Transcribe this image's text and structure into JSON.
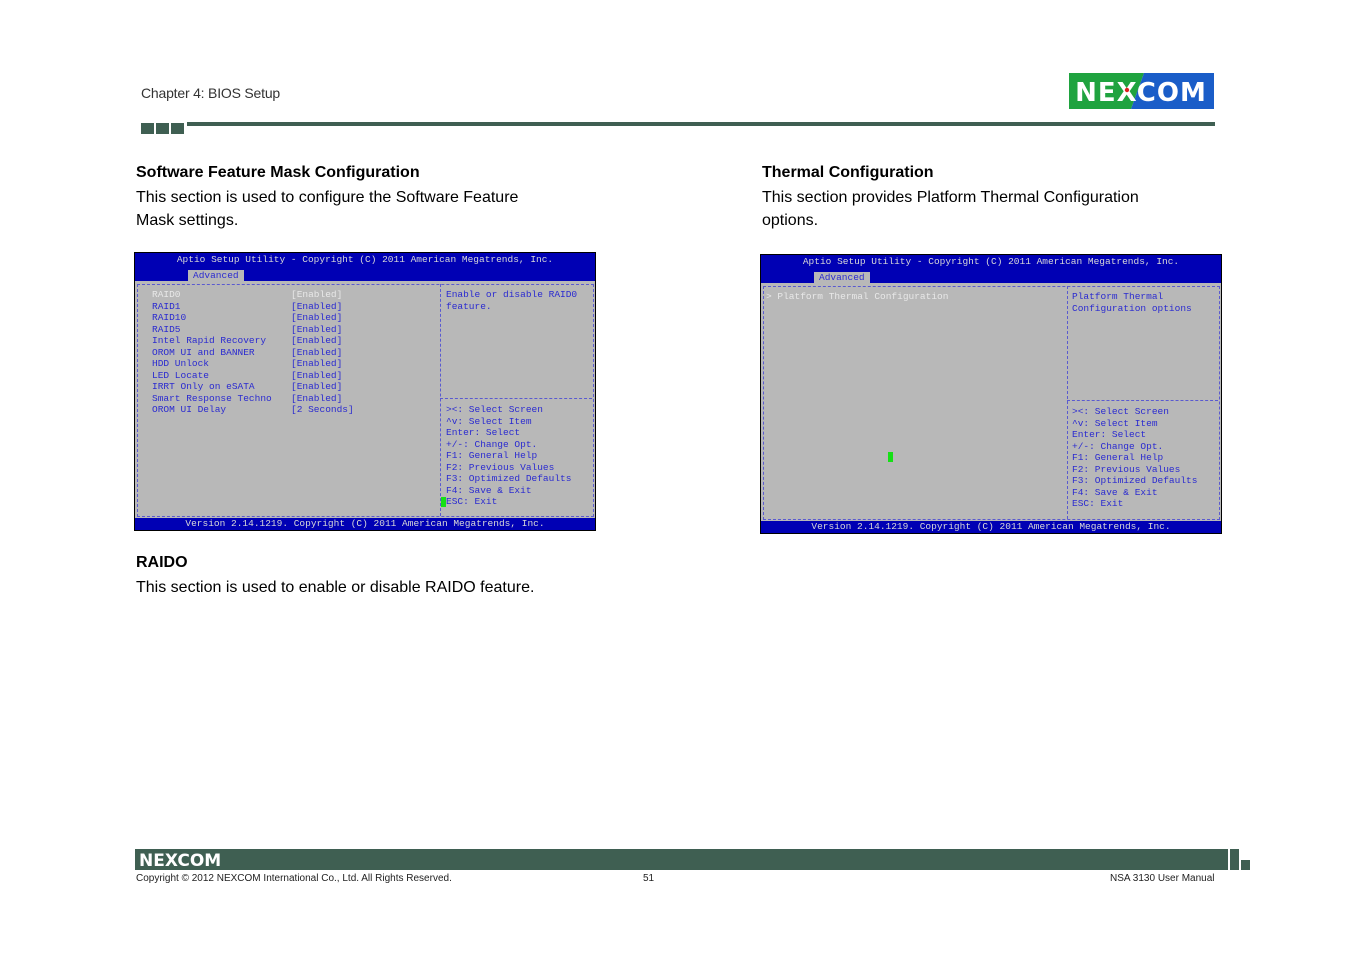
{
  "header": {
    "chapter": "Chapter 4: BIOS Setup",
    "logo_text": "NEXCOM",
    "brand_colors": {
      "green": "#1fa33f",
      "blue": "#1a5dc8",
      "rule": "#3f5f52"
    }
  },
  "left": {
    "section1": {
      "title": "Software Feature Mask Configuration",
      "body_line1": "This section is used to configure the Software Feature",
      "body_line2": "Mask settings."
    },
    "bios": {
      "title": "Aptio Setup Utility - Copyright (C) 2011 American Megatrends, Inc.",
      "tab": "Advanced",
      "items": [
        {
          "label": "RAID0",
          "value": "[Enabled]"
        },
        {
          "label": "RAID1",
          "value": "[Enabled]"
        },
        {
          "label": "RAID10",
          "value": "[Enabled]"
        },
        {
          "label": "RAID5",
          "value": "[Enabled]"
        },
        {
          "label": "Intel Rapid Recovery",
          "value": "[Enabled]"
        },
        {
          "label": "OROM UI and BANNER",
          "value": "[Enabled]"
        },
        {
          "label": "HDD Unlock",
          "value": "[Enabled]"
        },
        {
          "label": "LED Locate",
          "value": "[Enabled]"
        },
        {
          "label": "IRRT Only on eSATA",
          "value": "[Enabled]"
        },
        {
          "label": "Smart Response Techno",
          "value": "[Enabled]"
        },
        {
          "label": "OROM UI Delay",
          "value": "[2 Seconds]"
        }
      ],
      "help": [
        "Enable or disable RAID0",
        "feature."
      ],
      "keys": [
        "><: Select Screen",
        "^v: Select Item",
        "Enter: Select",
        "+/-: Change Opt.",
        "F1: General Help",
        "F2: Previous Values",
        "F3: Optimized Defaults",
        "F4: Save & Exit",
        "ESC: Exit"
      ],
      "footer": "Version 2.14.1219. Copyright (C) 2011 American Megatrends, Inc."
    },
    "section2": {
      "title": "RAIDO",
      "body": "This section is used to enable or disable RAIDO feature."
    }
  },
  "right": {
    "section": {
      "title": "Thermal Configuration",
      "body_line1": "This section provides Platform Thermal Configuration",
      "body_line2": "options."
    },
    "bios": {
      "title": "Aptio Setup Utility - Copyright (C) 2011 American Megatrends, Inc.",
      "tab": "Advanced",
      "items": [
        {
          "label": "> Platform Thermal Configuration"
        }
      ],
      "help": [
        "Platform Thermal",
        "Configuration options"
      ],
      "keys": [
        "><: Select Screen",
        "^v: Select Item",
        "Enter: Select",
        "+/-: Change Opt.",
        "F1: General Help",
        "F2: Previous Values",
        "F3: Optimized Defaults",
        "F4: Save & Exit",
        "ESC: Exit"
      ],
      "footer": "Version 2.14.1219. Copyright (C) 2011 American Megatrends, Inc."
    }
  },
  "footer": {
    "logo_text": "NEXCOM",
    "copyright": "Copyright © 2012 NEXCOM International Co., Ltd. All Rights Reserved.",
    "page_number": "51",
    "manual_name": "NSA 3130 User Manual"
  }
}
